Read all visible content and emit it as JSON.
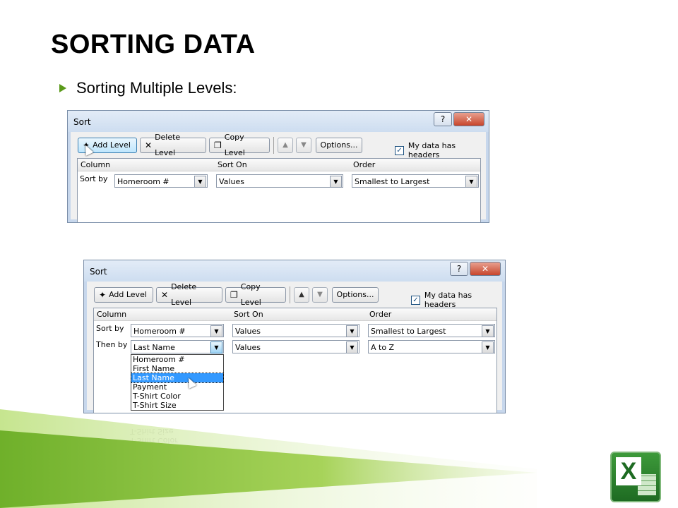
{
  "slide": {
    "title": "SORTING DATA",
    "bullet": "Sorting Multiple Levels:"
  },
  "dialog1": {
    "title": "Sort",
    "help": "?",
    "close": "✕",
    "add_level": "Add Level",
    "delete_level": "Delete Level",
    "copy_level": "Copy Level",
    "options": "Options...",
    "headers_label": "My data has headers",
    "headers_checked": true,
    "col_column": "Column",
    "col_sort_on": "Sort On",
    "col_order": "Order",
    "row1": {
      "label": "Sort by",
      "column": "Homeroom #",
      "sort_on": "Values",
      "order": "Smallest to Largest"
    }
  },
  "dialog2": {
    "title": "Sort",
    "help": "?",
    "close": "✕",
    "add_level": "Add Level",
    "delete_level": "Delete Level",
    "copy_level": "Copy Level",
    "options": "Options...",
    "headers_label": "My data has headers",
    "headers_checked": true,
    "col_column": "Column",
    "col_sort_on": "Sort On",
    "col_order": "Order",
    "row1": {
      "label": "Sort by",
      "column": "Homeroom #",
      "sort_on": "Values",
      "order": "Smallest to Largest"
    },
    "row2": {
      "label": "Then by",
      "column": "Last Name",
      "sort_on": "Values",
      "order": "A to Z"
    },
    "dropdown_options": [
      "Homeroom #",
      "First Name",
      "Last Name",
      "Payment",
      "T-Shirt Color",
      "T-Shirt Size"
    ],
    "selected_option": "Last Name"
  },
  "icons": {
    "add": "add-level-icon",
    "delete": "delete-x-icon",
    "copy": "copy-icon",
    "up": "move-up-icon",
    "down": "move-down-icon",
    "dropdown": "chevron-down-icon",
    "app_logo": "excel-logo-icon"
  },
  "colors": {
    "accent_green": "#5a9a1a",
    "title_bar": "#cdddf0",
    "close_red": "#c7452c",
    "selection": "#3399ff"
  }
}
